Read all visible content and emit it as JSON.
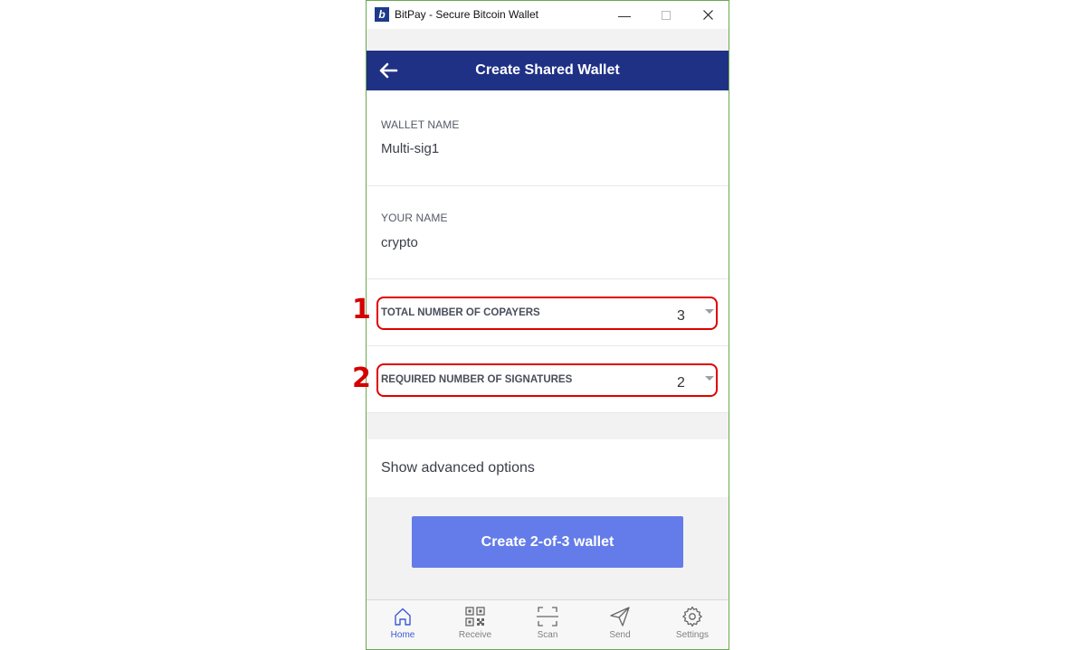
{
  "window": {
    "title": "BitPay - Secure Bitcoin Wallet",
    "logo_letter": "b",
    "minimize": "—",
    "maximize": "☐",
    "close": "✕"
  },
  "header": {
    "title": "Create Shared Wallet",
    "back_icon": "arrow-left-icon"
  },
  "form": {
    "wallet_name": {
      "label": "WALLET NAME",
      "value": "Multi-sig1"
    },
    "your_name": {
      "label": "YOUR NAME",
      "value": "crypto"
    },
    "copayers": {
      "label": "TOTAL NUMBER OF COPAYERS",
      "value": "3"
    },
    "signatures": {
      "label": "REQUIRED NUMBER OF SIGNATURES",
      "value": "2"
    },
    "advanced_label": "Show advanced options",
    "create_label": "Create 2-of-3 wallet"
  },
  "annotations": {
    "marker_1": "1",
    "marker_2": "2"
  },
  "nav": {
    "items": [
      {
        "label": "Home",
        "icon": "home-icon",
        "active": true
      },
      {
        "label": "Receive",
        "icon": "qr-code-icon",
        "active": false
      },
      {
        "label": "Scan",
        "icon": "scan-icon",
        "active": false
      },
      {
        "label": "Send",
        "icon": "paper-plane-icon",
        "active": false
      },
      {
        "label": "Settings",
        "icon": "gear-icon",
        "active": false
      }
    ]
  },
  "colors": {
    "header_bg": "#1f3185",
    "button_bg": "#647ce9",
    "highlight": "#e00000",
    "active_nav": "#3a5bd6"
  }
}
